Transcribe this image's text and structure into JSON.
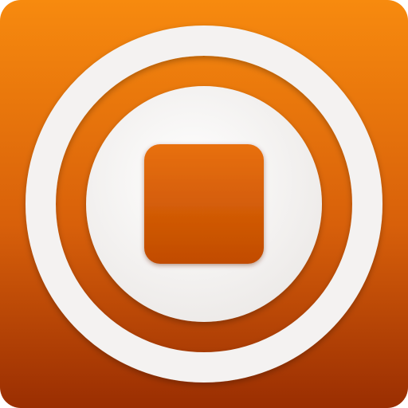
{
  "icon": {
    "name": "stop-record-icon",
    "colors": {
      "gradient_top": "#F78A0E",
      "gradient_bottom": "#9A2E02",
      "ring": "#F4F2F1",
      "center_light": "#FFFFFF",
      "stop_square_top": "#E8700C",
      "stop_square_bottom": "#C14B02"
    }
  }
}
